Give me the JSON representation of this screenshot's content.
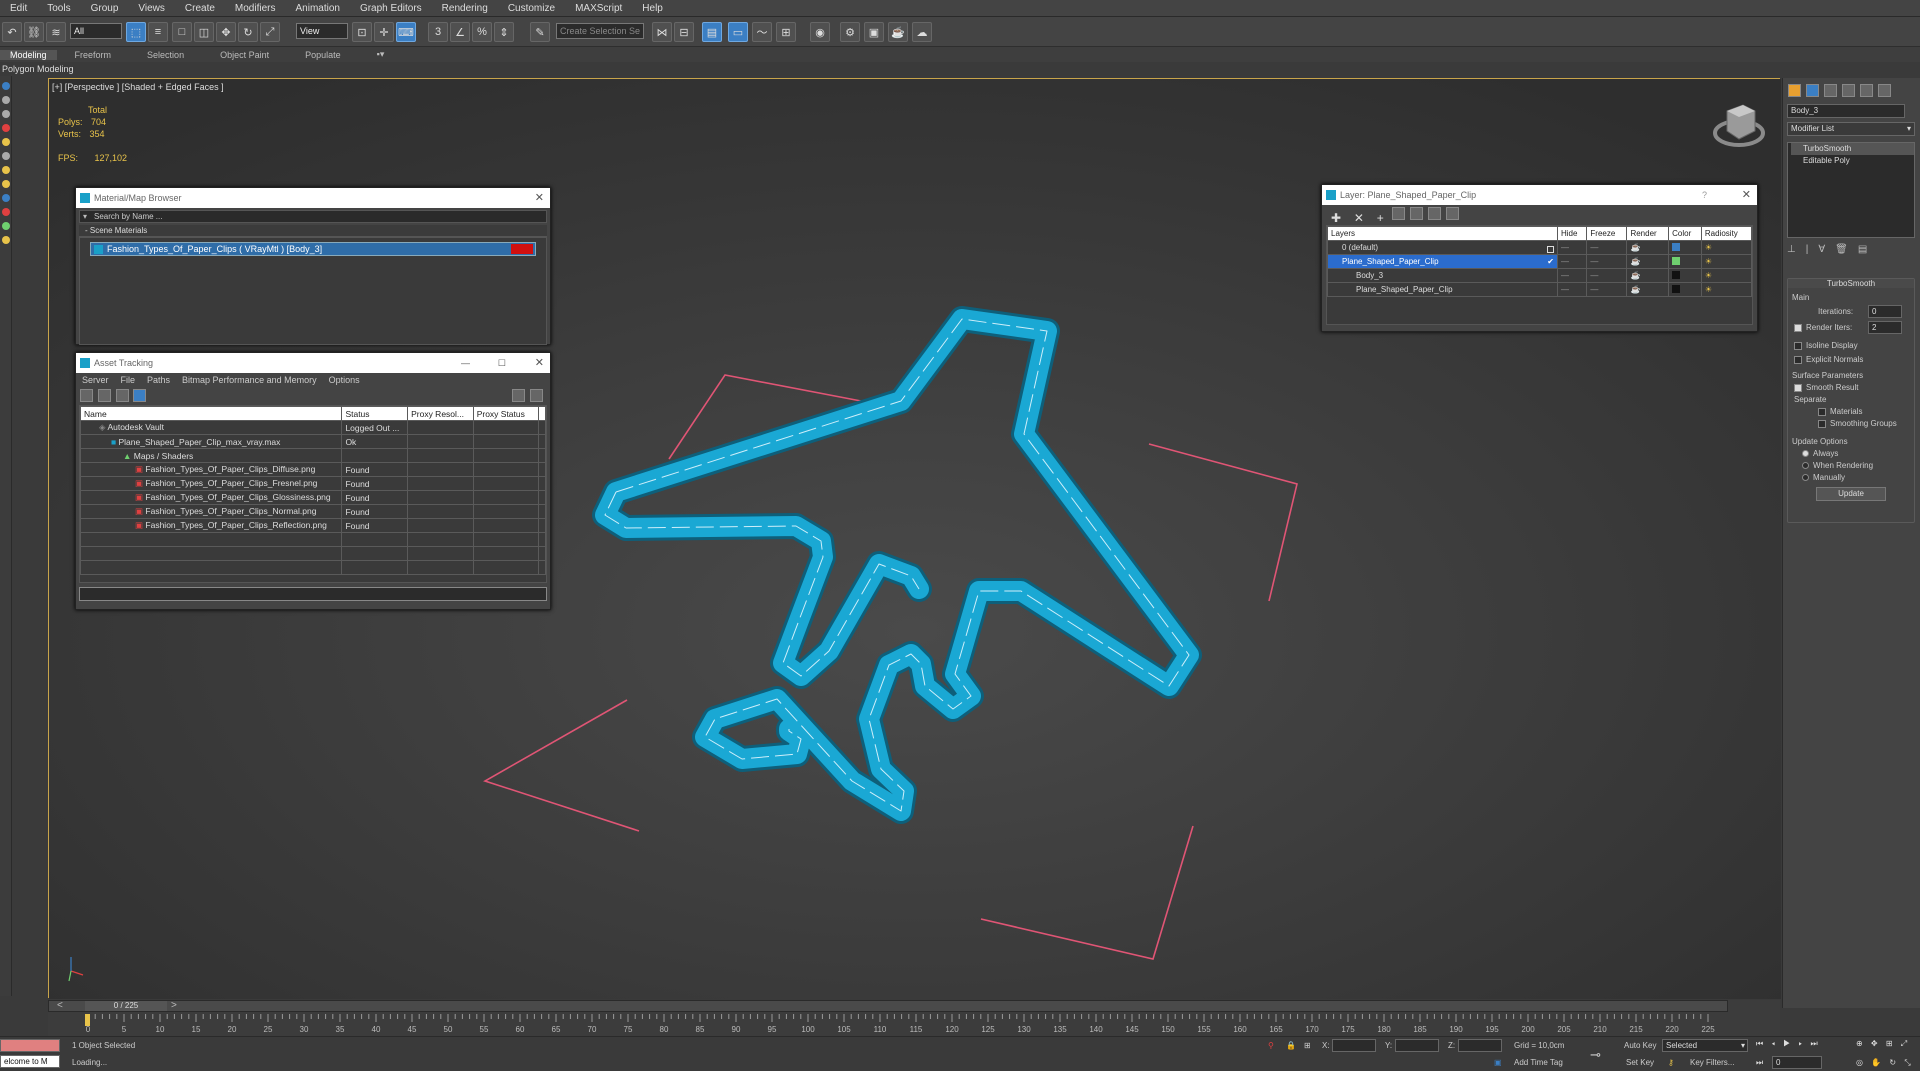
{
  "menu": [
    "Edit",
    "Tools",
    "Group",
    "Views",
    "Create",
    "Modifiers",
    "Animation",
    "Graph Editors",
    "Rendering",
    "Customize",
    "MAXScript",
    "Help"
  ],
  "toolbar": {
    "filter_value": "All",
    "refcoord_value": "View",
    "selection_set_placeholder": "Create Selection Se"
  },
  "ribbon": {
    "tabs": [
      "Modeling",
      "Freeform",
      "Selection",
      "Object Paint",
      "Populate"
    ],
    "sub_label": "Polygon Modeling"
  },
  "viewport": {
    "label": "[+] [Perspective ] [Shaded + Edged Faces ]",
    "stats": {
      "total_label": "Total",
      "polys_label": "Polys:",
      "polys_value": "704",
      "verts_label": "Verts:",
      "verts_value": "354",
      "fps_label": "FPS:",
      "fps_value": "127,102"
    },
    "object_color": "#1aa0c8"
  },
  "material_browser": {
    "title": "Material/Map Browser",
    "search_placeholder": "Search by Name ...",
    "section": "- Scene Materials",
    "material": "Fashion_Types_Of_Paper_Clips ( VRayMtl ) [Body_3]",
    "swatch_color": "#d01010"
  },
  "asset_tracking": {
    "title": "Asset Tracking",
    "menu": [
      "Server",
      "File",
      "Paths",
      "Bitmap Performance and Memory",
      "Options"
    ],
    "columns": [
      "Name",
      "Status",
      "Proxy Resol...",
      "Proxy Status"
    ],
    "rows": [
      {
        "name": "Autodesk Vault",
        "status": "Logged Out ..."
      },
      {
        "name": "Plane_Shaped_Paper_Clip_max_vray.max",
        "status": "Ok"
      },
      {
        "name": "Maps / Shaders",
        "status": ""
      },
      {
        "name": "Fashion_Types_Of_Paper_Clips_Diffuse.png",
        "status": "Found"
      },
      {
        "name": "Fashion_Types_Of_Paper_Clips_Fresnel.png",
        "status": "Found"
      },
      {
        "name": "Fashion_Types_Of_Paper_Clips_Glossiness.png",
        "status": "Found"
      },
      {
        "name": "Fashion_Types_Of_Paper_Clips_Normal.png",
        "status": "Found"
      },
      {
        "name": "Fashion_Types_Of_Paper_Clips_Reflection.png",
        "status": "Found"
      }
    ]
  },
  "layer_panel": {
    "title": "Layer: Plane_Shaped_Paper_Clip",
    "help": "?",
    "columns": [
      "Layers",
      "Hide",
      "Freeze",
      "Render",
      "Color",
      "Radiosity"
    ],
    "rows": [
      {
        "name": "0 (default)",
        "color": "#3b7fc4"
      },
      {
        "name": "Plane_Shaped_Paper_Clip",
        "color": "#6fd06f"
      },
      {
        "name": "Body_3",
        "color": "#111111"
      },
      {
        "name": "Plane_Shaped_Paper_Clip",
        "color": "#111111"
      }
    ]
  },
  "command_panel": {
    "object_name": "Body_3",
    "modifier_list": "Modifier List",
    "stack": [
      "TurboSmooth",
      "Editable Poly"
    ],
    "rollout_title": "TurboSmooth",
    "main_label": "Main",
    "iterations_label": "Iterations:",
    "iterations_value": "0",
    "render_iters_label": "Render Iters:",
    "render_iters_value": "2",
    "isoline": "Isoline Display",
    "explicit": "Explicit Normals",
    "surface_label": "Surface Parameters",
    "smooth_result": "Smooth Result",
    "separate_label": "Separate",
    "materials": "Materials",
    "smoothing_groups": "Smoothing Groups",
    "update_options": "Update Options",
    "always": "Always",
    "when_rendering": "When Rendering",
    "manually": "Manually",
    "update_button": "Update"
  },
  "timeline": {
    "frame": "0 / 225",
    "ticks": [
      "0",
      "5",
      "10",
      "15",
      "20",
      "25",
      "30",
      "35",
      "40",
      "45",
      "50",
      "55",
      "60",
      "65",
      "70",
      "75",
      "80",
      "85",
      "90",
      "95",
      "100",
      "105",
      "110",
      "115",
      "120",
      "125",
      "130",
      "135",
      "140",
      "145",
      "150",
      "155",
      "160",
      "165",
      "170",
      "175",
      "180",
      "185",
      "190",
      "195",
      "200",
      "205",
      "210",
      "215",
      "220",
      "225"
    ]
  },
  "status": {
    "maxscript": "elcome to M",
    "selected": "1 Object Selected",
    "loading": "Loading...",
    "x_label": "X:",
    "y_label": "Y:",
    "z_label": "Z:",
    "grid": "Grid = 10,0cm",
    "add_time_tag": "Add Time Tag",
    "auto_key": "Auto Key",
    "set_key": "Set Key",
    "selected_dropdown": "Selected",
    "key_filters": "Key Filters...",
    "frame_value": "0"
  }
}
